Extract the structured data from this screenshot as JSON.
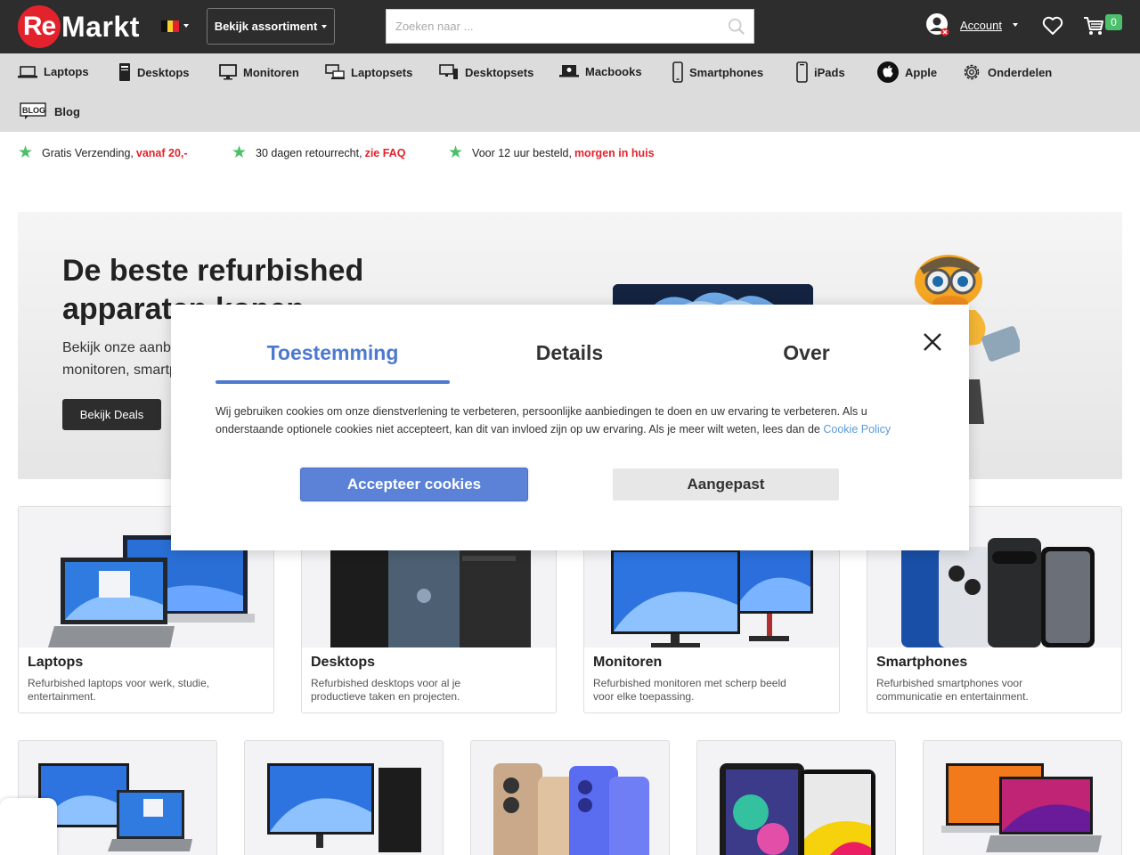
{
  "header": {
    "logo_re": "Re",
    "logo_rest": "Markt",
    "assortment_label": "Bekijk assortiment",
    "search_placeholder": "Zoeken naar ...",
    "account_label": "Account",
    "cart_count": "0",
    "colors": {
      "brand_red": "#e4222c",
      "header_bg": "#2d2d2d",
      "badge_green": "#4cbf6a"
    }
  },
  "nav": {
    "items": [
      {
        "label": "Laptops",
        "icon": "laptop-icon"
      },
      {
        "label": "Desktops",
        "icon": "desktop-tower-icon"
      },
      {
        "label": "Monitoren",
        "icon": "monitor-icon"
      },
      {
        "label": "Laptopsets",
        "icon": "laptopset-icon"
      },
      {
        "label": "Desktopsets",
        "icon": "desktopset-icon"
      },
      {
        "label": "Macbooks",
        "icon": "macbook-icon"
      },
      {
        "label": "Smartphones",
        "icon": "smartphone-icon"
      },
      {
        "label": "iPads",
        "icon": "tablet-icon"
      },
      {
        "label": "Apple",
        "icon": "apple-icon"
      },
      {
        "label": "Onderdelen",
        "icon": "gear-icon"
      },
      {
        "label": "Blog",
        "icon": "blog-icon"
      }
    ]
  },
  "usps": [
    {
      "text": "Gratis Verzending,",
      "highlight": "vanaf 20,-"
    },
    {
      "text": "30 dagen retourrecht,",
      "highlight": "zie FAQ"
    },
    {
      "text": "Voor 12 uur besteld,",
      "highlight": "morgen in huis"
    }
  ],
  "hero": {
    "title": "De beste refurbished apparaten kopen",
    "subtitle_line1": "Bekijk onze aanbi",
    "subtitle_line2": "monitoren, smartp",
    "button": "Bekijk Deals"
  },
  "categories": [
    {
      "title": "Laptops",
      "desc": "Refurbished laptops voor werk, studie, entertainment."
    },
    {
      "title": "Desktops",
      "desc": "Refurbished desktops voor al je productieve taken en projecten."
    },
    {
      "title": "Monitoren",
      "desc": "Refurbished monitoren met scherp beeld voor elke toepassing."
    },
    {
      "title": "Smartphones",
      "desc": "Refurbished smartphones voor communicatie en entertainment."
    }
  ],
  "cookie_modal": {
    "tabs": [
      "Toestemming",
      "Details",
      "Over"
    ],
    "text": "Wij gebruiken cookies om onze dienstverlening te verbeteren, persoonlijke aanbiedingen te doen en uw ervaring te verbeteren. Als u onderstaande optionele cookies niet accepteert, kan dit van invloed zijn op uw ervaring. Als je meer wilt weten, lees dan de",
    "link": "Cookie Policy",
    "accept": "Accepteer cookies",
    "custom": "Aangepast",
    "colors": {
      "accent_blue": "#4d79cf"
    }
  }
}
